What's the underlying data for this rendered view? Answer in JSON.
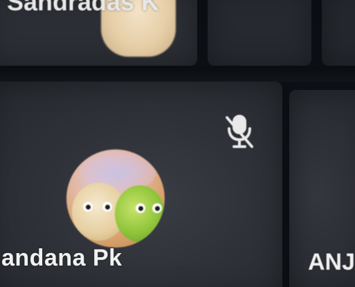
{
  "meeting": {
    "participants": [
      {
        "name": "Sandradas K",
        "position": "top"
      },
      {
        "name": "andana Pk",
        "position": "main",
        "muted": true
      },
      {
        "name": "ANJ",
        "position": "right"
      }
    ]
  },
  "icons": {
    "mute": "microphone-muted-icon"
  },
  "colors": {
    "tile_background": "#2f3238",
    "name_text": "#f2f2f2",
    "page_background": "#0c0f14"
  }
}
